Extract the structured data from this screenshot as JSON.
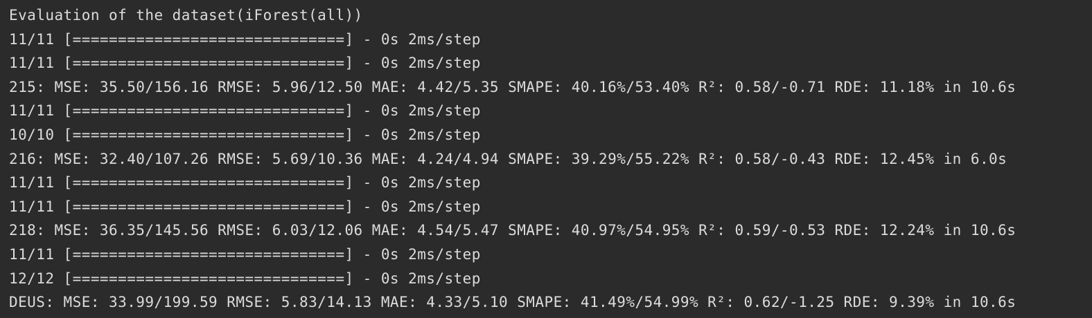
{
  "console": {
    "lines": [
      "Evaluation of the dataset(iForest(all))",
      "11/11 [==============================] - 0s 2ms/step",
      "11/11 [==============================] - 0s 2ms/step",
      "215: MSE: 35.50/156.16 RMSE: 5.96/12.50 MAE: 4.42/5.35 SMAPE: 40.16%/53.40% R²: 0.58/-0.71 RDE: 11.18% in 10.6s",
      "11/11 [==============================] - 0s 2ms/step",
      "10/10 [==============================] - 0s 2ms/step",
      "216: MSE: 32.40/107.26 RMSE: 5.69/10.36 MAE: 4.24/4.94 SMAPE: 39.29%/55.22% R²: 0.58/-0.43 RDE: 12.45% in 6.0s",
      "11/11 [==============================] - 0s 2ms/step",
      "11/11 [==============================] - 0s 2ms/step",
      "218: MSE: 36.35/145.56 RMSE: 6.03/12.06 MAE: 4.54/5.47 SMAPE: 40.97%/54.95% R²: 0.59/-0.53 RDE: 12.24% in 10.6s",
      "11/11 [==============================] - 0s 2ms/step",
      "12/12 [==============================] - 0s 2ms/step",
      "DEUS: MSE: 33.99/199.59 RMSE: 5.83/14.13 MAE: 4.33/5.10 SMAPE: 41.49%/54.99% R²: 0.62/-1.25 RDE: 9.39% in 10.6s"
    ]
  },
  "colors": {
    "background": "#2b2b2b",
    "text": "#dcdcdc"
  }
}
